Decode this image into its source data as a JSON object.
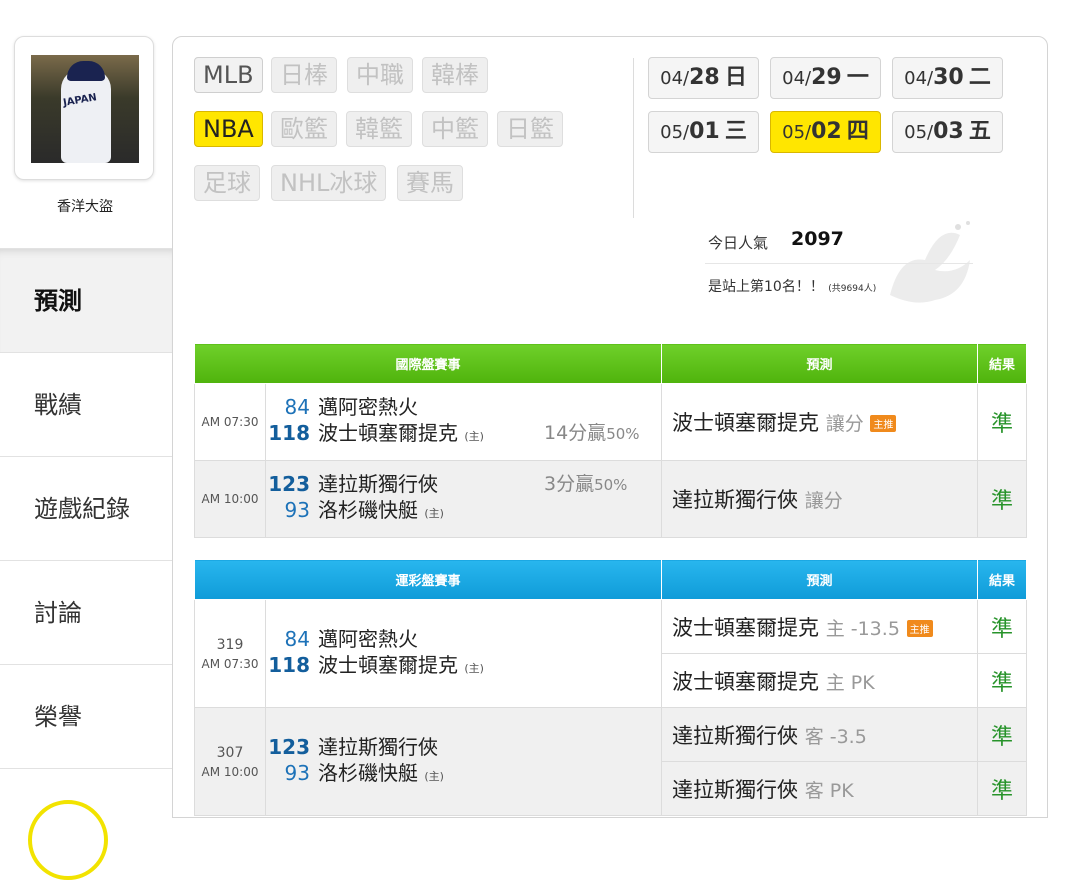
{
  "sidebar": {
    "username": "香洋大盜",
    "avatar_text": "JAPAN",
    "items": [
      {
        "label": "預測",
        "active": true
      },
      {
        "label": "戰績"
      },
      {
        "label": "遊戲紀錄"
      },
      {
        "label": "討論"
      },
      {
        "label": "榮譽"
      }
    ]
  },
  "sports": {
    "row1": [
      "MLB",
      "日棒",
      "中職",
      "韓棒"
    ],
    "row2": [
      "NBA",
      "歐籃",
      "韓籃",
      "中籃",
      "日籃"
    ],
    "row3": [
      "足球",
      "NHL冰球",
      "賽馬"
    ],
    "active": "NBA"
  },
  "dates": [
    {
      "md": "04/",
      "dd": "28",
      "wd": "日"
    },
    {
      "md": "04/",
      "dd": "29",
      "wd": "一"
    },
    {
      "md": "04/",
      "dd": "30",
      "wd": "二"
    },
    {
      "md": "05/",
      "dd": "01",
      "wd": "三"
    },
    {
      "md": "05/",
      "dd": "02",
      "wd": "四",
      "active": true
    },
    {
      "md": "05/",
      "dd": "03",
      "wd": "五"
    }
  ],
  "popularity": {
    "label": "今日人氣",
    "value": "2097",
    "rank_text": "是站上第10名！！",
    "rank_total": "(共9694人)"
  },
  "intl_table": {
    "headers": [
      "國際盤賽事",
      "預測",
      "結果"
    ],
    "games": [
      {
        "time": "AM 07:30",
        "away": {
          "score": "84",
          "team": "邁阿密熱火"
        },
        "home": {
          "score": "118",
          "team": "波士頓塞爾提克",
          "host": "(主)",
          "handicap": "14分贏",
          "pct": "50%"
        },
        "winner": "home",
        "pred_team": "波士頓塞爾提克",
        "pred_type": "讓分",
        "badge": "主推",
        "result": "準"
      },
      {
        "time": "AM 10:00",
        "away": {
          "score": "123",
          "team": "達拉斯獨行俠",
          "handicap": "3分贏",
          "pct": "50%"
        },
        "home": {
          "score": "93",
          "team": "洛杉磯快艇",
          "host": "(主)"
        },
        "winner": "away",
        "pred_team": "達拉斯獨行俠",
        "pred_type": "讓分",
        "result": "準"
      }
    ]
  },
  "lottery_table": {
    "headers": [
      "運彩盤賽事",
      "預測",
      "結果"
    ],
    "games": [
      {
        "num": "319",
        "time": "AM 07:30",
        "away": {
          "score": "84",
          "team": "邁阿密熱火"
        },
        "home": {
          "score": "118",
          "team": "波士頓塞爾提克",
          "host": "(主)"
        },
        "winner": "home",
        "preds": [
          {
            "team": "波士頓塞爾提克",
            "type": "主 -13.5",
            "badge": "主推",
            "result": "準"
          },
          {
            "team": "波士頓塞爾提克",
            "type": "主 PK",
            "result": "準"
          }
        ]
      },
      {
        "num": "307",
        "time": "AM 10:00",
        "away": {
          "score": "123",
          "team": "達拉斯獨行俠"
        },
        "home": {
          "score": "93",
          "team": "洛杉磯快艇",
          "host": "(主)"
        },
        "winner": "away",
        "preds": [
          {
            "team": "達拉斯獨行俠",
            "type": "客 -3.5",
            "result": "準"
          },
          {
            "team": "達拉斯獨行俠",
            "type": "客 PK",
            "result": "準"
          }
        ]
      }
    ]
  },
  "colors": {
    "active_yellow": "#ffe600",
    "green_header": "#4fb30c",
    "blue_header": "#0f9bd8",
    "result_green": "#27932a"
  }
}
